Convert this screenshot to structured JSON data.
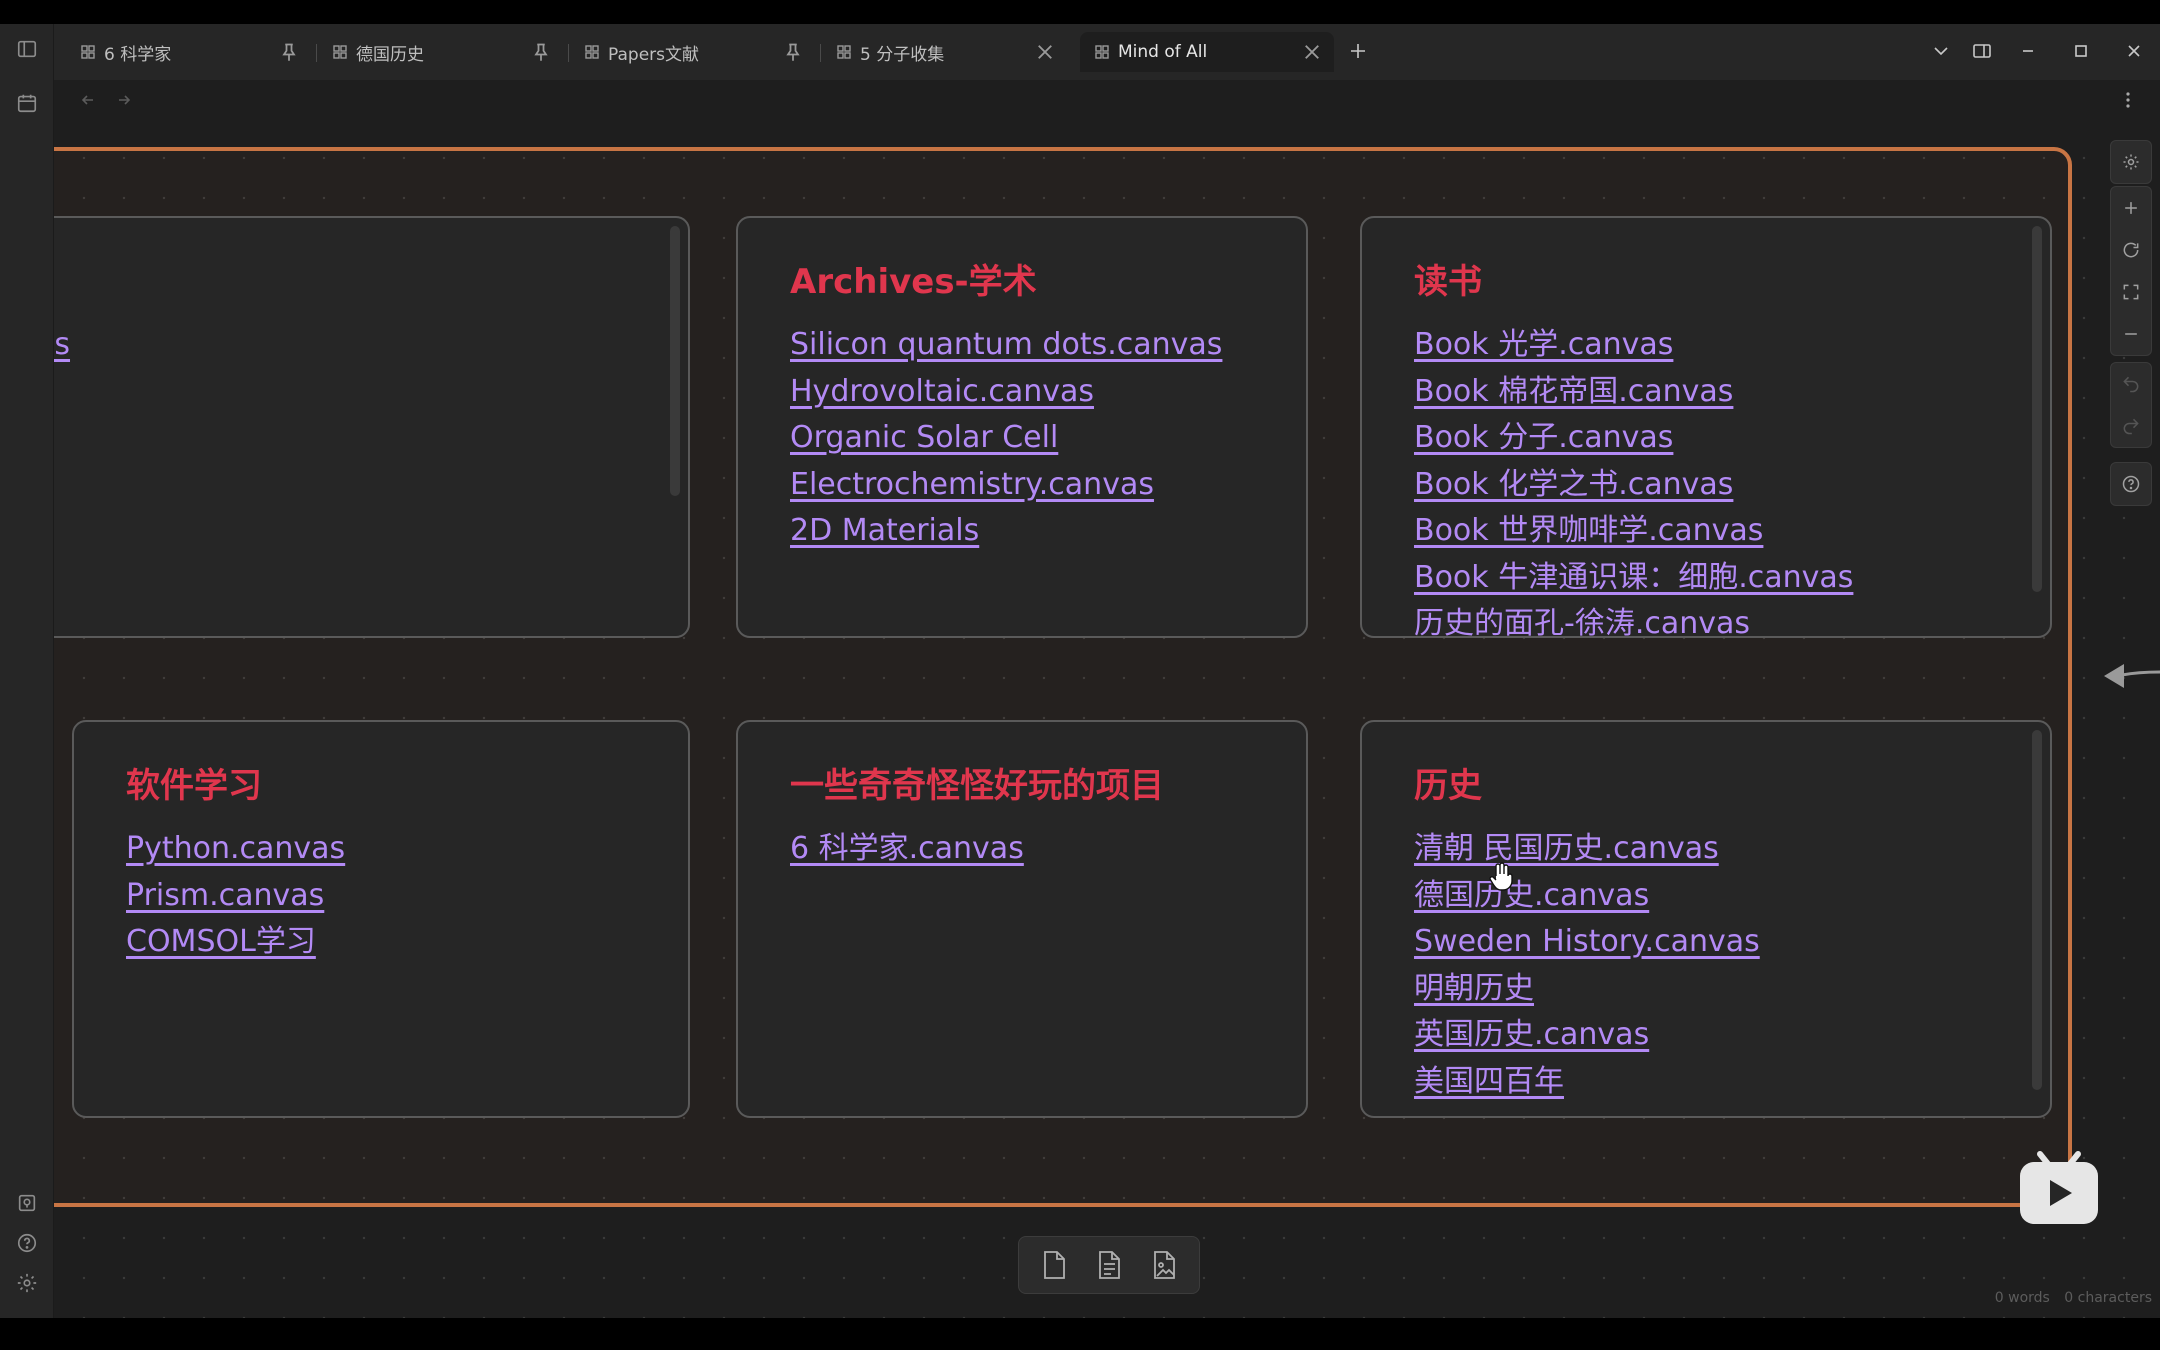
{
  "tabs": [
    {
      "label": "6 科学家",
      "end_icon": "pin-icon"
    },
    {
      "label": "德国历史",
      "end_icon": "pin-icon"
    },
    {
      "label": "Papers文献",
      "end_icon": "pin-icon"
    },
    {
      "label": "5 分子收集",
      "end_icon": "close-icon"
    },
    {
      "label": "Mind of All",
      "end_icon": "close-icon",
      "active": true
    }
  ],
  "cards": [
    {
      "title": "",
      "links": [
        "as"
      ]
    },
    {
      "title": "Archives-学术",
      "links": [
        "Silicon quantum dots.canvas",
        "Hydrovoltaic.canvas",
        "Organic Solar Cell",
        "Electrochemistry.canvas",
        "2D Materials"
      ]
    },
    {
      "title": "读书",
      "links": [
        "Book 光学.canvas",
        "Book 棉花帝国.canvas",
        "Book 分子.canvas",
        "Book 化学之书.canvas",
        "Book 世界咖啡学.canvas",
        "Book 牛津通识课：细胞.canvas",
        "历史的面孔-徐涛.canvas"
      ]
    },
    {
      "title": "软件学习",
      "links": [
        "Python.canvas",
        "Prism.canvas",
        "COMSOL学习"
      ]
    },
    {
      "title": "一些奇奇怪怪好玩的项目",
      "links": [
        "6 科学家.canvas"
      ]
    },
    {
      "title": "历史",
      "links": [
        "清朝 民国历史.canvas",
        "德国历史.canvas",
        "Sweden History.canvas",
        "明朝历史",
        "英国历史.canvas",
        "美国四百年"
      ]
    }
  ],
  "status": {
    "words": "0 words",
    "characters": "0 characters"
  },
  "colors": {
    "group_border": "#c87544",
    "card_title": "#e0364d",
    "link": "#b38af5",
    "background": "#1e1e1e"
  }
}
